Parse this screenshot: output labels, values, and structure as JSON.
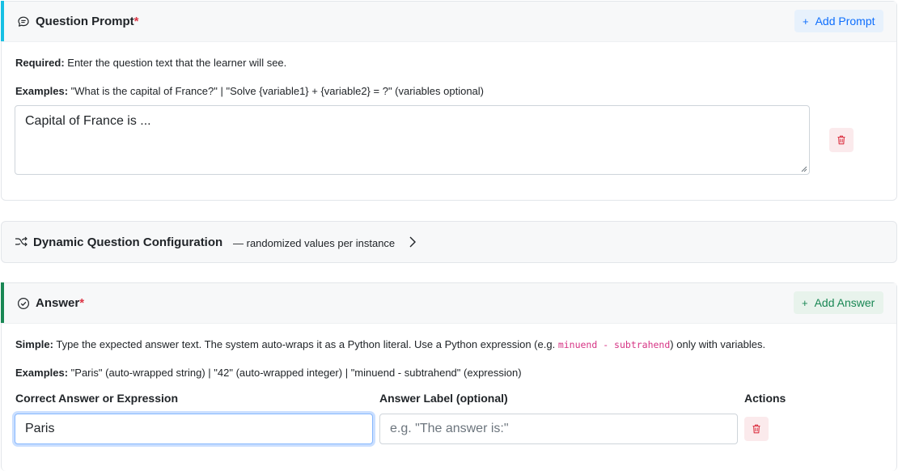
{
  "question_prompt": {
    "title": "Question Prompt",
    "required_mark": "*",
    "icon": "chat-bubble-icon",
    "accent_color": "#17c0e4",
    "add_button_label": "Add Prompt",
    "required_label": "Required:",
    "required_text": " Enter the question text that the learner will see.",
    "examples_label": "Examples:",
    "examples_text": " \"What is the capital of France?\" | \"Solve {variable1} + {variable2} = ?\" (variables optional)",
    "prompt_value": "Capital of France is ..."
  },
  "dynamic_config": {
    "title": "Dynamic Question Configuration",
    "subtitle": "— randomized values per instance",
    "icon": "shuffle-icon",
    "chevron_icon": "chevron-right-icon"
  },
  "answer": {
    "title": "Answer",
    "required_mark": "*",
    "icon": "check-circle-icon",
    "accent_color": "#198754",
    "add_button_label": "Add Answer",
    "simple_label": "Simple:",
    "simple_text_1": " Type the expected answer text. The system auto-wraps it as a Python literal. Use a Python expression (e.g. ",
    "simple_code": "minuend - subtrahend",
    "simple_text_2": ") only with variables.",
    "examples_label": "Examples:",
    "examples_text": " \"Paris\" (auto-wrapped string) | \"42\" (auto-wrapped integer) | \"minuend - subtrahend\" (expression)",
    "col_answer_label": "Correct Answer or Expression",
    "col_label_label": "Answer Label (optional)",
    "col_actions_label": "Actions",
    "answer_value": "Paris",
    "label_placeholder": "e.g. \"The answer is:\""
  }
}
